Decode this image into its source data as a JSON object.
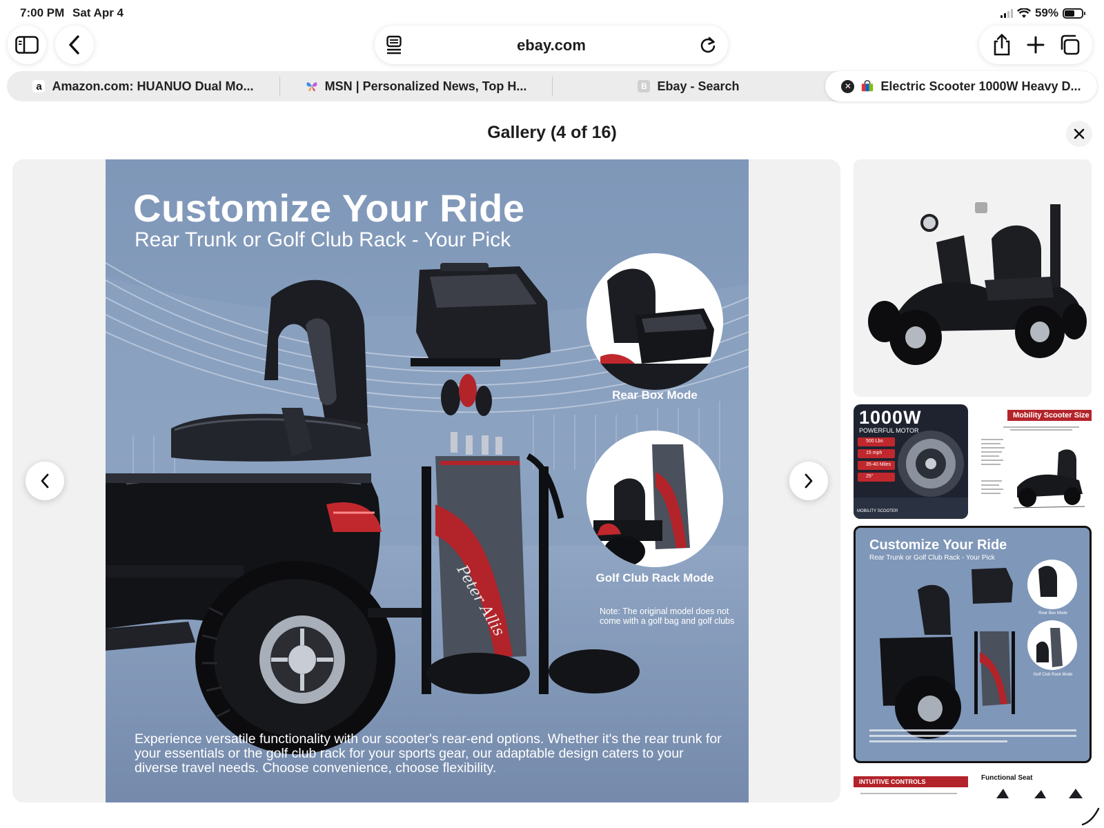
{
  "status_bar": {
    "time": "7:00 PM",
    "date": "Sat Apr 4",
    "battery": "59%"
  },
  "address_bar": {
    "host": "ebay.com"
  },
  "tabs": [
    {
      "label": "Amazon.com: HUANUO Dual Mo...",
      "favicon": "a"
    },
    {
      "label": "MSN | Personalized News, Top H...",
      "favicon": "msn"
    },
    {
      "label": "Ebay - Search",
      "favicon": "B"
    },
    {
      "label": "Electric Scooter 1000W Heavy D...",
      "favicon": "ebay",
      "active": true
    }
  ],
  "gallery": {
    "title": "Gallery (4 of 16)",
    "main_image": {
      "headline": "Customize Your Ride",
      "subhead": "Rear Trunk or Golf Club Rack - Your Pick",
      "rear_box_caption": "Rear Box Mode",
      "golf_rack_caption": "Golf Club Rack Mode",
      "note": "Note: The original model does not come with a golf bag and golf clubs",
      "description": "Experience versatile functionality with our scooter's rear-end options. Whether it's the rear trunk for your essentials or the golf club rack for your sports gear, our adaptable design caters to your diverse travel needs. Choose convenience, choose flexibility.",
      "bag_script": "Peter Allis"
    },
    "thumbnails": {
      "motor": {
        "headline": "1000W",
        "subtitle": "POWERFUL MOTOR",
        "specs": [
          "500 Lbs",
          "15 mph",
          "35-40 Miles",
          "25°"
        ],
        "footer": "MOBILITY SCOOTER"
      },
      "size": {
        "title": "Mobility Scooter Size"
      },
      "selected": {
        "headline": "Customize Your Ride",
        "subhead": "Rear Trunk or Golf Club Rack - Your Pick",
        "rear_box_caption": "Rear Box Mode",
        "golf_rack_caption": "Golf Club Rack Mode"
      },
      "controls": {
        "title": "INTUITIVE CONTROLS"
      },
      "seat": {
        "title": "Functional Seat"
      }
    }
  },
  "colors": {
    "image_bg": "#8299b9",
    "accent_red": "#c0282d",
    "dark_panel": "#1f2330"
  }
}
